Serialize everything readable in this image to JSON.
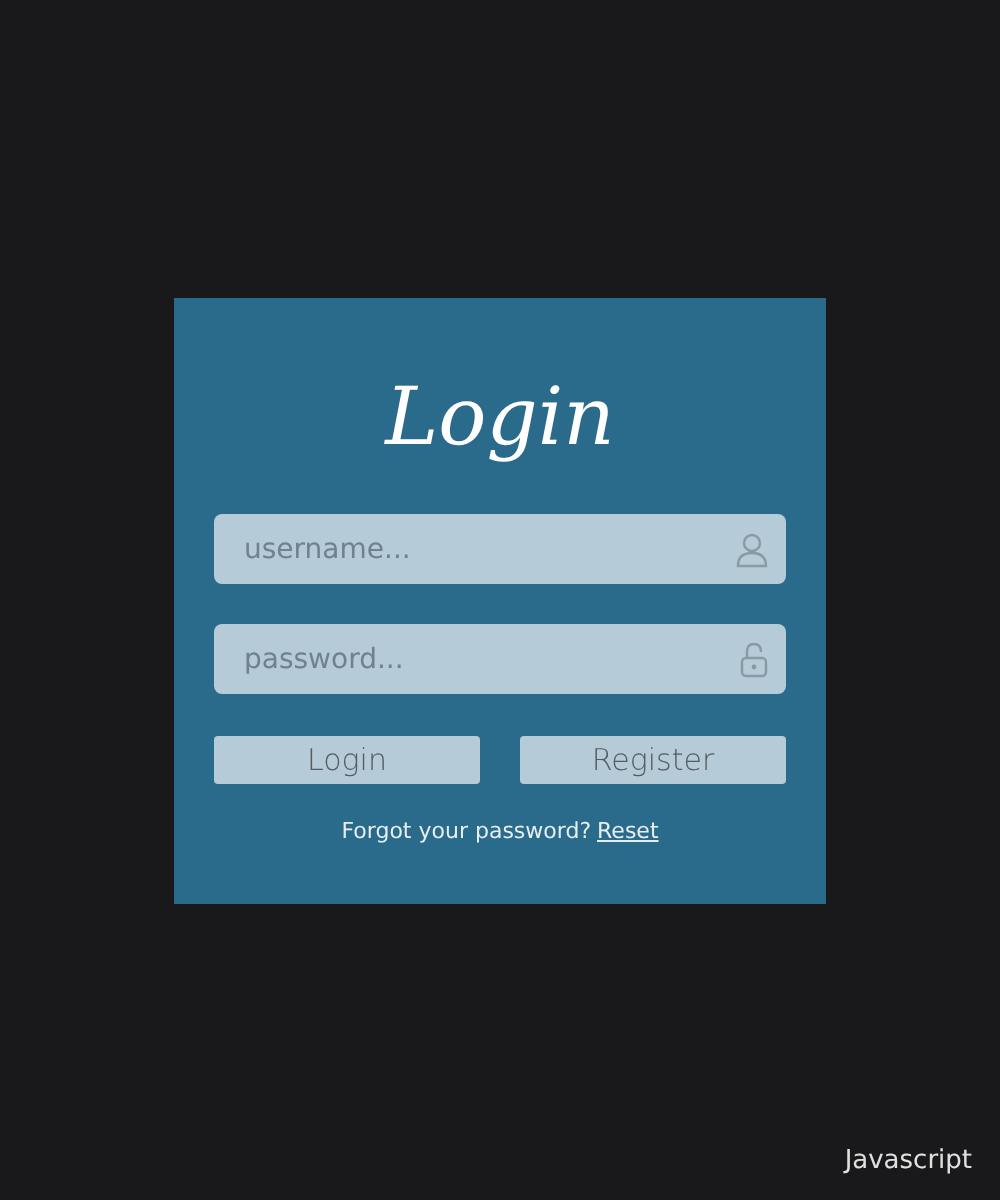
{
  "card": {
    "title": "Login",
    "fields": [
      {
        "kind": "user",
        "placeholder": "username..."
      },
      {
        "kind": "lock",
        "placeholder": "password..."
      }
    ],
    "buttons": [
      "Login",
      "Register"
    ],
    "footer": {
      "text": "Forgot your password?",
      "link": "Reset"
    }
  },
  "corner_label": "Javascript"
}
